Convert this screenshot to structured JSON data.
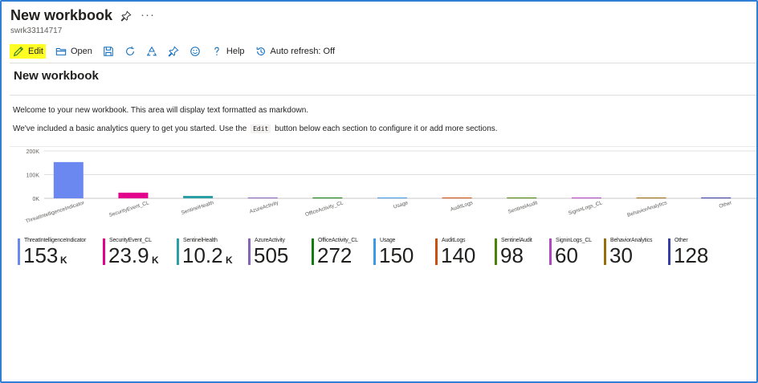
{
  "header": {
    "title": "New workbook",
    "subtitle": "swrk33114717",
    "more_label": "···"
  },
  "toolbar": {
    "edit_label": "Edit",
    "open_label": "Open",
    "help_label": "Help",
    "auto_refresh_label": "Auto refresh: Off",
    "edit_highlight_color": "#ffff24",
    "icons": [
      "pencil-icon",
      "folder-open-icon",
      "save-icon",
      "refresh-icon",
      "recycle-icon",
      "pin-icon",
      "smiley-icon",
      "help-icon",
      "clock-refresh-icon"
    ]
  },
  "workbook": {
    "title": "New workbook",
    "para1": "Welcome to your new workbook. This area will display text formatted as markdown.",
    "para2_before": "We've included a basic analytics query to get you started. Use the",
    "para2_code": "Edit",
    "para2_after": "button below each section to configure it or add more sections."
  },
  "chart_data": {
    "type": "bar",
    "categories": [
      "ThreatIntelligenceIndicator",
      "SecurityEvent_CL",
      "SentinelHealth",
      "AzureActivity",
      "OfficeActivity_CL",
      "Usage",
      "AuditLogs",
      "SentinelAudit",
      "SigninLogs_CL",
      "BehaviorAnalytics",
      "Other"
    ],
    "values": [
      153000,
      23900,
      10200,
      505,
      272,
      150,
      140,
      98,
      60,
      30,
      128
    ],
    "colors": [
      "#6b87f0",
      "#e3008c",
      "#2aa0a4",
      "#8764b8",
      "#107c10",
      "#3b99e6",
      "#ca5010",
      "#498205",
      "#b146c2",
      "#986f0b",
      "#3a3fa6"
    ],
    "yticks": [
      "200K",
      "100K",
      "0K"
    ],
    "ylim": [
      0,
      200000
    ],
    "grid": true,
    "legend": "none"
  },
  "tiles": [
    {
      "label": "ThreatIntelligenceIndicator",
      "value": "153",
      "unit": "K",
      "color": "#6b87f0"
    },
    {
      "label": "SecurityEvent_CL",
      "value": "23.9",
      "unit": "K",
      "color": "#e3008c"
    },
    {
      "label": "SentinelHealth",
      "value": "10.2",
      "unit": "K",
      "color": "#2aa0a4"
    },
    {
      "label": "AzureActivity",
      "value": "505",
      "unit": "",
      "color": "#8764b8"
    },
    {
      "label": "OfficeActivity_CL",
      "value": "272",
      "unit": "",
      "color": "#107c10"
    },
    {
      "label": "Usage",
      "value": "150",
      "unit": "",
      "color": "#3b99e6"
    },
    {
      "label": "AuditLogs",
      "value": "140",
      "unit": "",
      "color": "#ca5010"
    },
    {
      "label": "SentinelAudit",
      "value": "98",
      "unit": "",
      "color": "#498205"
    },
    {
      "label": "SigninLogs_CL",
      "value": "60",
      "unit": "",
      "color": "#b146c2"
    },
    {
      "label": "BehaviorAnalytics",
      "value": "30",
      "unit": "",
      "color": "#986f0b"
    },
    {
      "label": "Other",
      "value": "128",
      "unit": "",
      "color": "#3a3fa6"
    }
  ]
}
